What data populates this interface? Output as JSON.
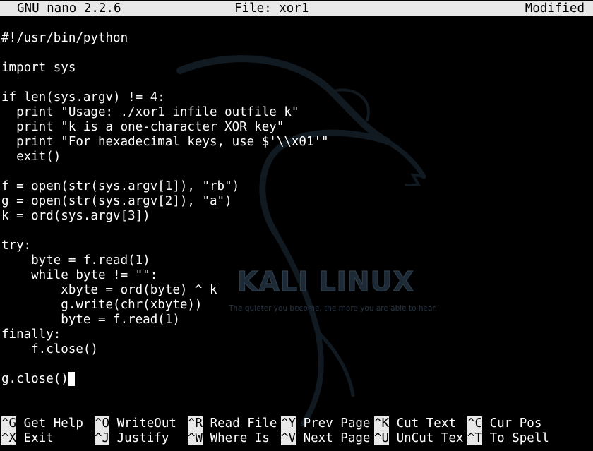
{
  "titlebar": {
    "app": "GNU nano 2.2.6",
    "file": "File: xor1",
    "status": "Modified"
  },
  "wallpaper": {
    "brand": "KALI LINUX",
    "tagline": "The quieter you become, the more you are able to hear."
  },
  "editor": {
    "lines": [
      "#!/usr/bin/python",
      "",
      "import sys",
      "",
      "if len(sys.argv) != 4:",
      "  print \"Usage: ./xor1 infile outfile k\"",
      "  print \"k is a one-character XOR key\"",
      "  print \"For hexadecimal keys, use $'\\\\x01'\"",
      "  exit()",
      "",
      "f = open(str(sys.argv[1]), \"rb\")",
      "g = open(str(sys.argv[2]), \"a\")",
      "k = ord(sys.argv[3])",
      "",
      "try:",
      "    byte = f.read(1)",
      "    while byte != \"\":",
      "        xbyte = ord(byte) ^ k",
      "        g.write(chr(xbyte))",
      "        byte = f.read(1)",
      "finally:",
      "    f.close()",
      "",
      "g.close()"
    ]
  },
  "shortcuts": {
    "row1": [
      {
        "key": "^G",
        "label": "Get Help"
      },
      {
        "key": "^O",
        "label": "WriteOut"
      },
      {
        "key": "^R",
        "label": "Read File"
      },
      {
        "key": "^Y",
        "label": "Prev Page"
      },
      {
        "key": "^K",
        "label": "Cut Text"
      },
      {
        "key": "^C",
        "label": "Cur Pos"
      }
    ],
    "row2": [
      {
        "key": "^X",
        "label": "Exit"
      },
      {
        "key": "^J",
        "label": "Justify"
      },
      {
        "key": "^W",
        "label": "Where Is"
      },
      {
        "key": "^V",
        "label": "Next Page"
      },
      {
        "key": "^U",
        "label": "UnCut Tex"
      },
      {
        "key": "^T",
        "label": "To Spell"
      }
    ]
  },
  "colors": {
    "background": "#000000",
    "text": "#ffffff",
    "bar": "#e8e8e8",
    "logo": "#1b2530"
  }
}
